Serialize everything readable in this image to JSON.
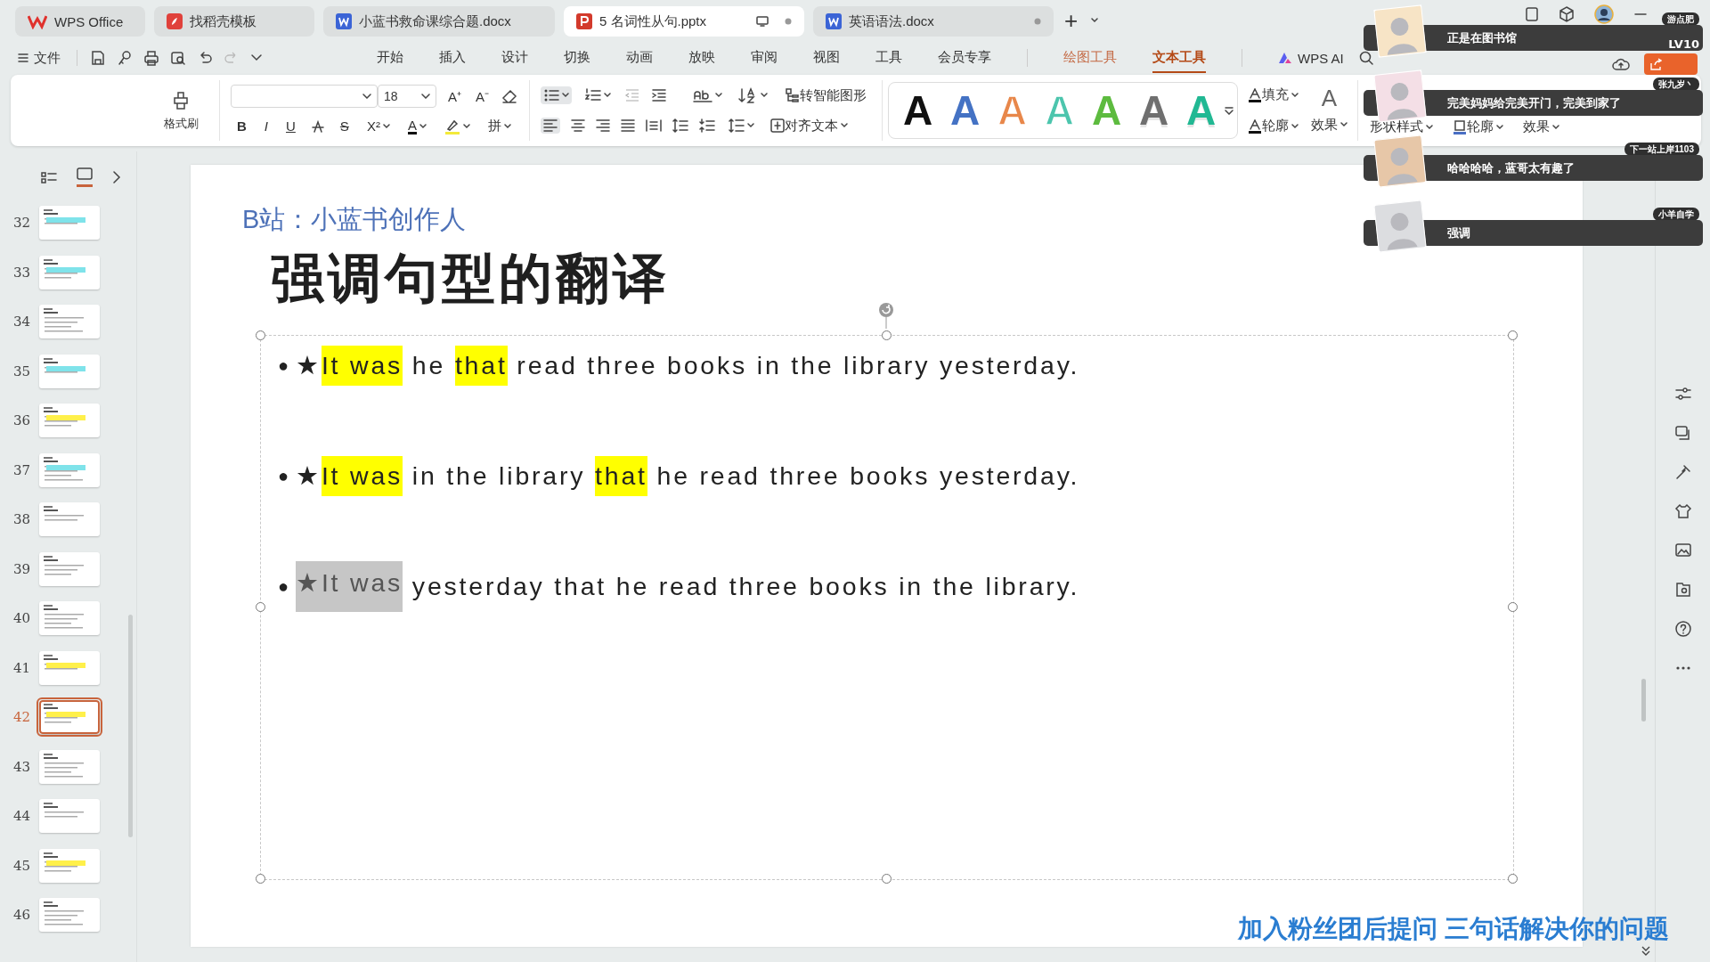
{
  "tabs": [
    {
      "label": "WPS Office",
      "kind": "home",
      "selected": false,
      "unsaved": false
    },
    {
      "label": "找稻壳模板",
      "kind": "template",
      "selected": false,
      "unsaved": false
    },
    {
      "label": "小蓝书救命课综合题.docx",
      "kind": "doc",
      "selected": false,
      "unsaved": false
    },
    {
      "label": "5 名词性从句.pptx",
      "kind": "ppt",
      "selected": true,
      "unsaved": true
    },
    {
      "label": "英语语法.docx",
      "kind": "doc",
      "selected": false,
      "unsaved": true
    }
  ],
  "new_tab": "+",
  "menu": {
    "file": "文件",
    "items": [
      {
        "label": "开始",
        "kind": "normal",
        "selected": false
      },
      {
        "label": "插入",
        "kind": "normal",
        "selected": false
      },
      {
        "label": "设计",
        "kind": "normal",
        "selected": false
      },
      {
        "label": "切换",
        "kind": "normal",
        "selected": false
      },
      {
        "label": "动画",
        "kind": "normal",
        "selected": false
      },
      {
        "label": "放映",
        "kind": "normal",
        "selected": false
      },
      {
        "label": "审阅",
        "kind": "normal",
        "selected": false
      },
      {
        "label": "视图",
        "kind": "normal",
        "selected": false
      },
      {
        "label": "工具",
        "kind": "normal",
        "selected": false
      },
      {
        "label": "会员专享",
        "kind": "normal",
        "selected": false
      },
      {
        "label": "绘图工具",
        "kind": "context",
        "selected": false
      },
      {
        "label": "文本工具",
        "kind": "context",
        "selected": true
      }
    ],
    "ai": "WPS AI"
  },
  "ribbon": {
    "format_painter": "格式刷",
    "font_size": "18",
    "grow": "A⁺",
    "shrink": "A⁻",
    "bold": "B",
    "italic": "I",
    "underline": "U",
    "strike": "S",
    "superscript": "X²",
    "font_color": "A",
    "phonetic": "拼",
    "bullets_on": true,
    "align_left_on": true,
    "smart_art": "转智能图形",
    "align_text": "对齐文本",
    "text_styles": [
      {
        "letter": "A",
        "kind": "solid",
        "color": "#111111"
      },
      {
        "letter": "A",
        "kind": "solid",
        "color": "#4472c4"
      },
      {
        "letter": "A",
        "kind": "outline",
        "color": "#e8874a"
      },
      {
        "letter": "A",
        "kind": "outline",
        "color": "#4cc5ad"
      },
      {
        "letter": "A",
        "kind": "solid",
        "color": "#5dbb3f"
      },
      {
        "letter": "A",
        "kind": "gradient",
        "color": "#6f6f6f"
      },
      {
        "letter": "A",
        "kind": "gradient",
        "color": "#21b893"
      }
    ],
    "fill": "填充",
    "outline": "轮廓",
    "effect": "效果",
    "effect_icon": "A",
    "shape_style": "形状样式",
    "shape_outline": "轮廓",
    "shape_effect": "效果"
  },
  "thumbnails": [
    {
      "number": "32",
      "selected": false,
      "color": "#7fe3ea"
    },
    {
      "number": "33",
      "selected": false,
      "color": "#7fe3ea"
    },
    {
      "number": "34",
      "selected": false
    },
    {
      "number": "35",
      "selected": false,
      "color": "#7fe3ea"
    },
    {
      "number": "36",
      "selected": false,
      "color": "#fff04a"
    },
    {
      "number": "37",
      "selected": false,
      "color": "#7fe3ea"
    },
    {
      "number": "38",
      "selected": false
    },
    {
      "number": "39",
      "selected": false
    },
    {
      "number": "40",
      "selected": false
    },
    {
      "number": "41",
      "selected": false,
      "color": "#fff04a"
    },
    {
      "number": "42",
      "selected": true,
      "color": "#fff04a"
    },
    {
      "number": "43",
      "selected": false
    },
    {
      "number": "44",
      "selected": false
    },
    {
      "number": "45",
      "selected": false,
      "color": "#fff04a"
    },
    {
      "number": "46",
      "selected": false
    }
  ],
  "slide": {
    "subtitle": "B站：小蓝书创作人",
    "title": "强调句型的翻译",
    "bullets": [
      {
        "bullet": "●",
        "segments": [
          {
            "text": "★",
            "highlighted": false,
            "selected": false
          },
          {
            "text": "It was",
            "highlighted": true,
            "selected": false
          },
          {
            "text": " he ",
            "highlighted": false,
            "selected": false
          },
          {
            "text": "that",
            "highlighted": true,
            "selected": false
          },
          {
            "text": " read three books in the library yesterday.",
            "highlighted": false,
            "selected": false
          }
        ]
      },
      {
        "bullet": "●",
        "segments": [
          {
            "text": "★",
            "highlighted": false,
            "selected": false
          },
          {
            "text": "It was",
            "highlighted": true,
            "selected": false
          },
          {
            "text": " in the library ",
            "highlighted": false,
            "selected": false
          },
          {
            "text": "that",
            "highlighted": true,
            "selected": false
          },
          {
            "text": " he read three books yesterday.",
            "highlighted": false,
            "selected": false
          }
        ]
      },
      {
        "bullet": "●",
        "segments": [
          {
            "text": "★It was",
            "highlighted": false,
            "selected": true
          },
          {
            "text": " yesterday that he read three books in the library.",
            "highlighted": false,
            "selected": false
          }
        ]
      }
    ]
  },
  "comments": [
    {
      "user": "游点肥",
      "message": "正是在图书馆",
      "level": "LV10"
    },
    {
      "user": "张九岁丶",
      "message": "完美妈妈给完美开门，完美到家了"
    },
    {
      "user": "下一站上岸1103",
      "message": "哈哈哈哈，蓝哥太有趣了"
    },
    {
      "user": "小羊自学",
      "message": "强调"
    }
  ],
  "caption": "加入粉丝团后提问 三句话解决你的问题"
}
